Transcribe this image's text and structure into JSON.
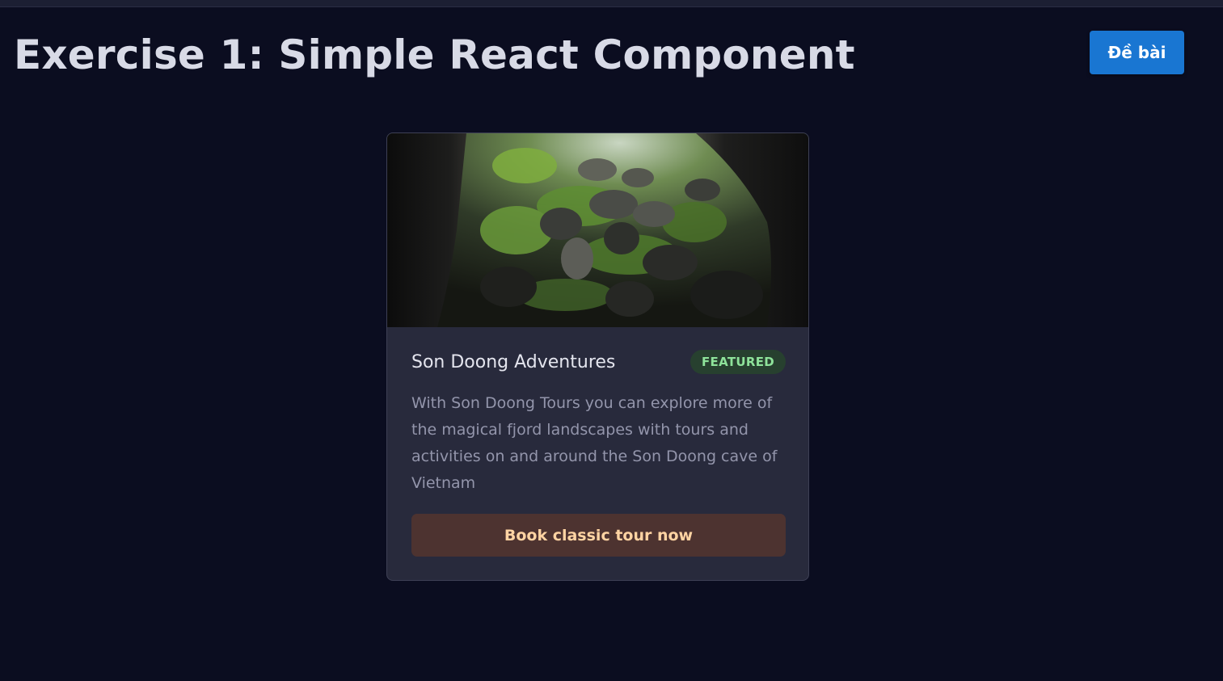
{
  "header": {
    "title": "Exercise 1: Simple React Component",
    "de_bai_label": "Đề bài"
  },
  "card": {
    "image_icon": "cave-photo",
    "title": "Son Doong Adventures",
    "badge": "FEATURED",
    "description": "With Son Doong Tours you can explore more of the magical fjord landscapes with tours and activities on and around the Son Doong cave of Vietnam",
    "cta_label": "Book classic tour now"
  },
  "colors": {
    "background": "#0b0d20",
    "card": "#282a3c",
    "primary_button": "#1976d2",
    "badge_bg": "#27402f",
    "badge_text": "#8ee29a",
    "cta_bg": "#4d3330",
    "cta_text": "#ffd4a3"
  }
}
